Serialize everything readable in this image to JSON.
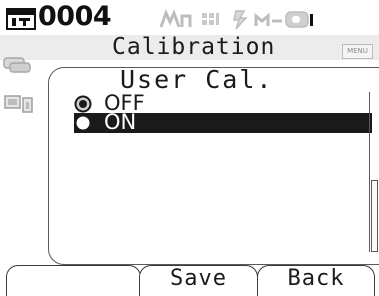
{
  "status_bar": {
    "target_label": "0004",
    "icons": [
      "target-memory-icon",
      "mode-icon",
      "grid-icon",
      "lightning-icon",
      "key-icon",
      "battery-icon"
    ]
  },
  "title_bar": {
    "title": "Calibration",
    "menu_key_label": "MENU"
  },
  "sidebar": {
    "icons": [
      "storage-icon",
      "display-settings-icon"
    ]
  },
  "dialog": {
    "title": "User Cal.",
    "options": [
      {
        "label": "OFF",
        "checked": true,
        "highlighted": false
      },
      {
        "label": "ON",
        "checked": false,
        "highlighted": true
      }
    ]
  },
  "softkeys": {
    "left_label": "",
    "save_label": "Save",
    "back_label": "Back"
  },
  "colors": {
    "highlight": "#1a1a1a",
    "titlebar_bg": "#ececec",
    "status_icons": "#bdbdbd"
  }
}
